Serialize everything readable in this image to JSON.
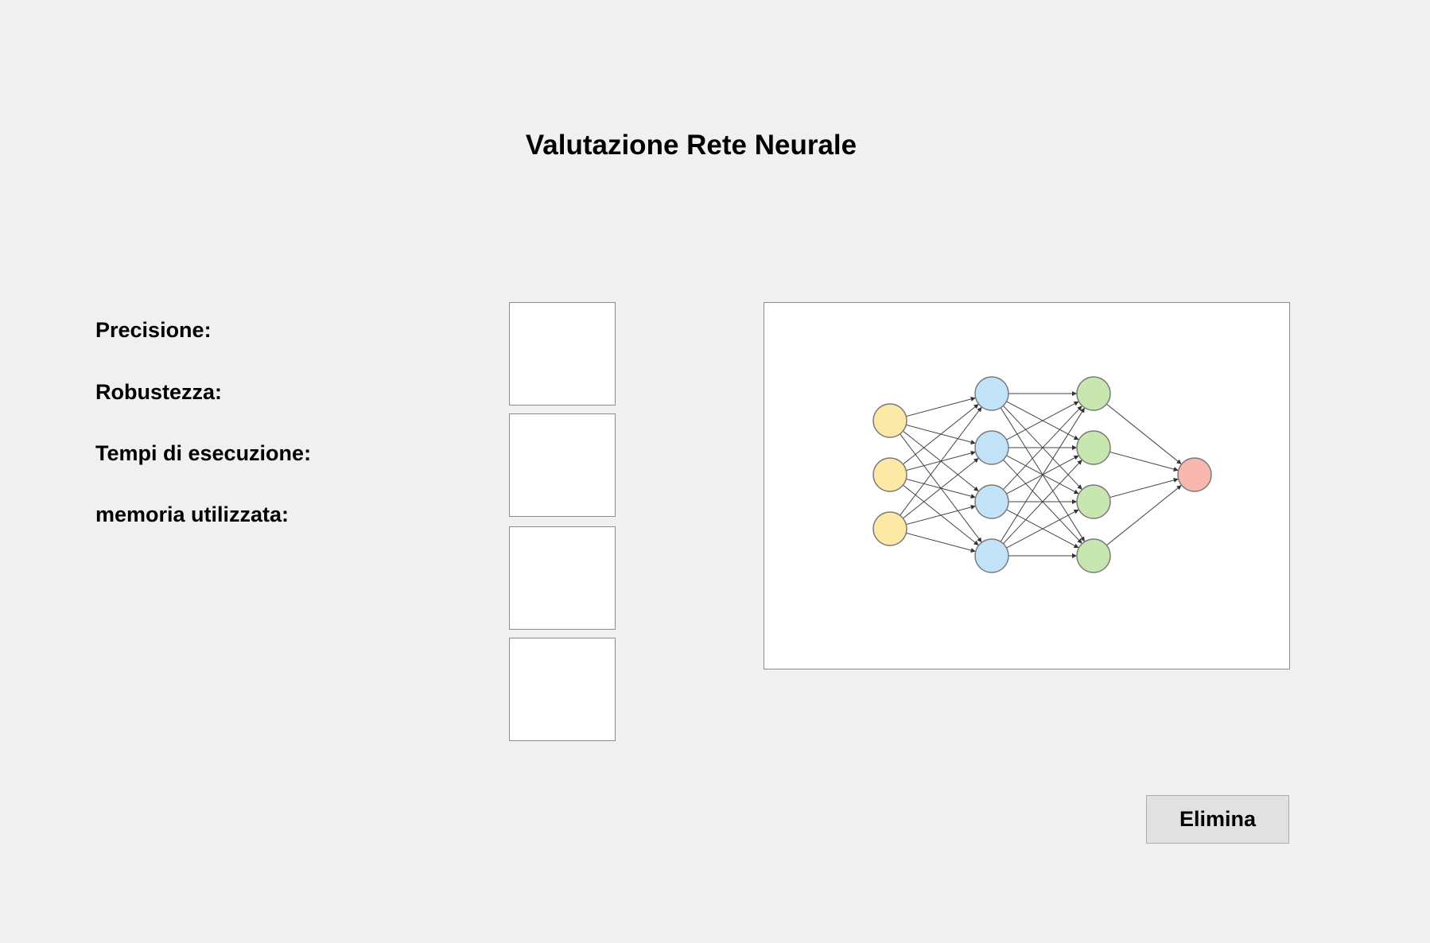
{
  "window": {
    "title": "Valutazione Rete Neurale"
  },
  "metrics": {
    "precision_label": "Precisione:",
    "robustness_label": "Robustezza:",
    "execution_time_label": "Tempi di esecuzione:",
    "memory_label": "memoria utilizzata:",
    "precision_value": "",
    "robustness_value": "",
    "execution_time_value": "",
    "memory_value": ""
  },
  "network_diagram": {
    "layers": [
      {
        "name": "input",
        "nodes": 3,
        "color": "#fde9a6"
      },
      {
        "name": "hidden-1",
        "nodes": 4,
        "color": "#c2e3f7"
      },
      {
        "name": "hidden-2",
        "nodes": 4,
        "color": "#c8e6b0"
      },
      {
        "name": "output",
        "nodes": 1,
        "color": "#f8b8b0"
      }
    ],
    "node_stroke": "#7a7a7a",
    "edge_color": "#444444"
  },
  "actions": {
    "delete_label": "Elimina"
  }
}
